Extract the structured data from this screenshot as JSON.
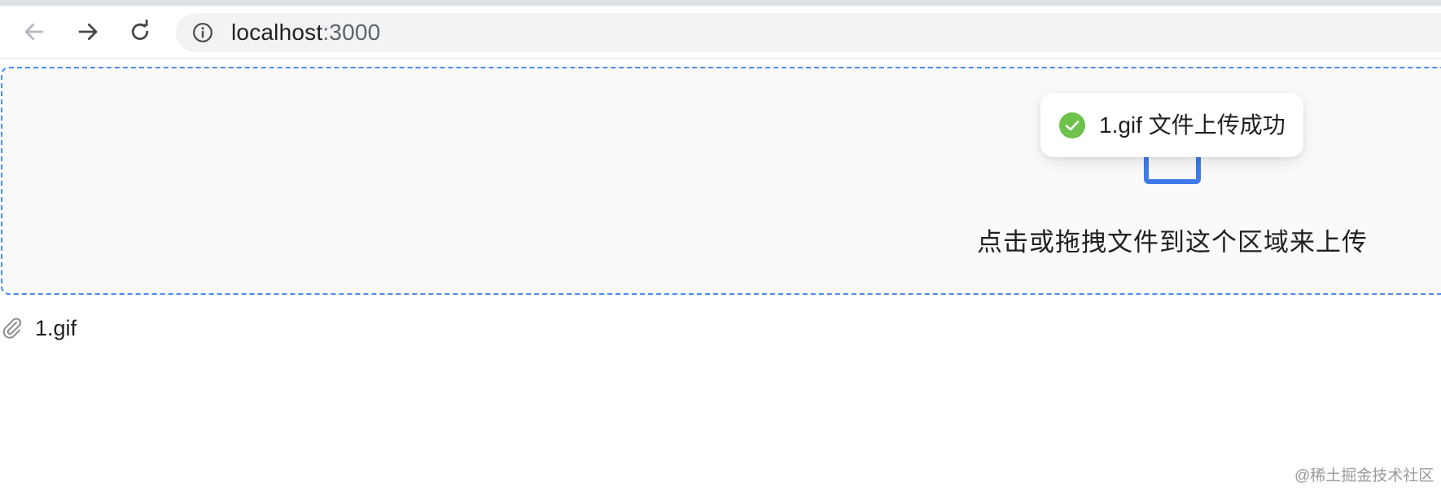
{
  "browser": {
    "url_host": "localhost",
    "url_port": ":3000",
    "icons": {
      "back": "arrow-left-icon",
      "forward": "arrow-right-icon",
      "reload": "reload-icon",
      "site_info": "info-icon"
    }
  },
  "upload": {
    "hint_text": "点击或拖拽文件到这个区域来上传",
    "icon": "upload-icon",
    "accent_color": "#3f7be8",
    "border_color": "#4b8bf0"
  },
  "file_list": [
    {
      "name": "1.gif",
      "icon": "paperclip-icon"
    }
  ],
  "toast": {
    "message": "1.gif 文件上传成功",
    "icon": "check-circle-icon",
    "success_color": "#6cc24a"
  },
  "watermark": {
    "text": "@稀土掘金技术社区"
  }
}
